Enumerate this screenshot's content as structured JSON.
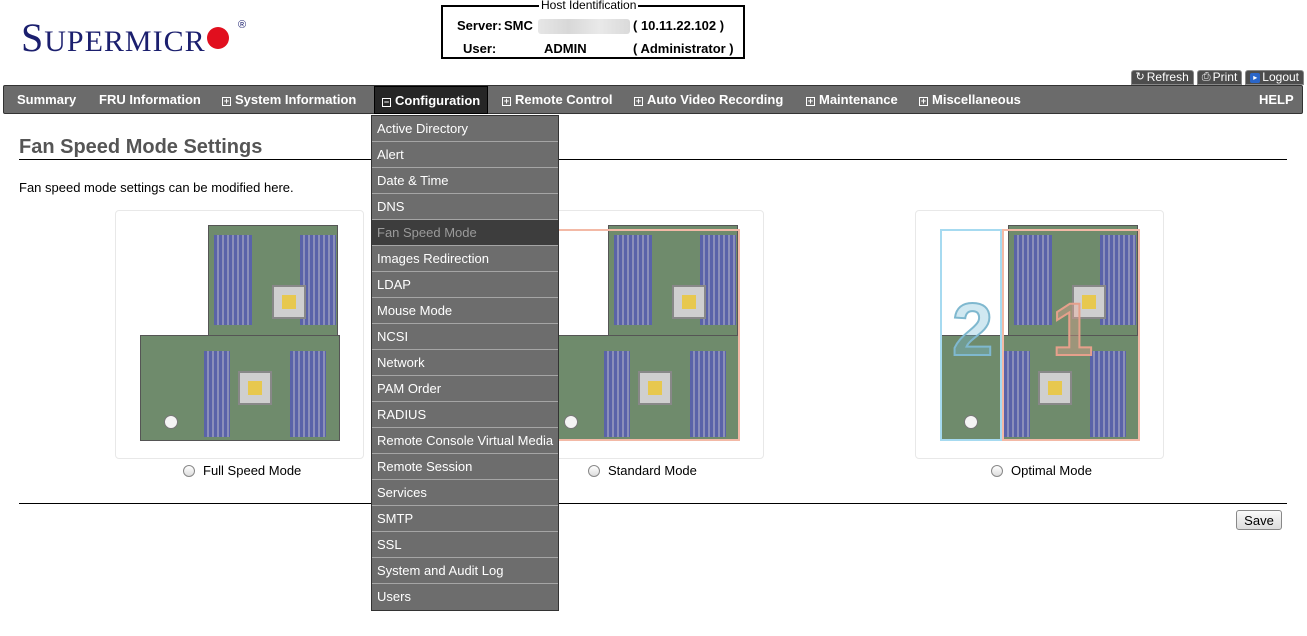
{
  "logo": {
    "text_big": "S",
    "text_small": "UPERMICR",
    "registered": "®"
  },
  "host": {
    "legend": "Host Identification",
    "server_label": "Server:",
    "server_prefix": "SMC",
    "server_ip": "( 10.11.22.102 )",
    "user_label": "User:",
    "user_name": "ADMIN",
    "user_role": "( Administrator )"
  },
  "top_buttons": [
    {
      "label": "Refresh",
      "icon": "refresh-icon"
    },
    {
      "label": "Print",
      "icon": "print-icon"
    },
    {
      "label": "Logout",
      "icon": "logout-icon"
    }
  ],
  "nav": {
    "summary": "Summary",
    "fru": "FRU Information",
    "system": "System Information",
    "configuration": "Configuration",
    "remote": "Remote Control",
    "video": "Auto Video Recording",
    "maintenance": "Maintenance",
    "misc": "Miscellaneous",
    "help": "HELP"
  },
  "page": {
    "title": "Fan Speed Mode Settings",
    "description": "Fan speed mode settings can be modified here."
  },
  "modes": [
    {
      "label": "Full Speed Mode"
    },
    {
      "label": "Standard Mode"
    },
    {
      "label": "Optimal Mode"
    }
  ],
  "zone_labels": {
    "zone2": "2",
    "zone1": "1"
  },
  "save_label": "Save",
  "dropdown": {
    "items": [
      "Active Directory",
      "Alert",
      "Date & Time",
      "DNS",
      "Fan Speed Mode",
      "Images Redirection",
      "LDAP",
      "Mouse Mode",
      "NCSI",
      "Network",
      "PAM Order",
      "RADIUS",
      "Remote Console Virtual Media",
      "Remote Session",
      "Services",
      "SMTP",
      "SSL",
      "System and Audit Log",
      "Users"
    ],
    "selected": "Fan Speed Mode"
  },
  "colors": {
    "nav_bg": "#6b6b6b",
    "nav_active": "#262626",
    "logo_blue": "#1b1f6e",
    "logo_red": "#e10f1e"
  }
}
